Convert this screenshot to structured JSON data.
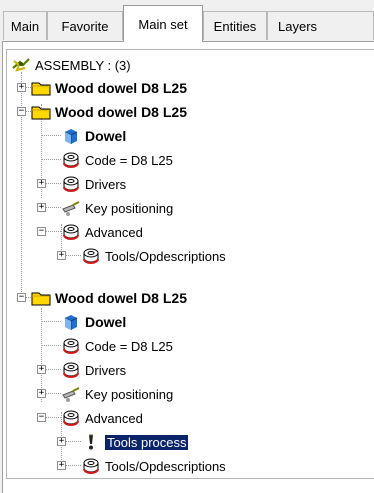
{
  "tabs": [
    {
      "label": "Main",
      "active": false
    },
    {
      "label": "Favorite",
      "active": false
    },
    {
      "label": "Main set",
      "active": true
    },
    {
      "label": "Entities",
      "active": false
    },
    {
      "label": "Layers",
      "active": false
    }
  ],
  "tree": {
    "root": {
      "label": "ASSEMBLY : (3)",
      "icon": "assembly-icon"
    },
    "nodes": [
      {
        "label": "Wood dowel D8 L25",
        "icon": "folder-icon",
        "expander": "+",
        "bold": true
      },
      {
        "label": "Wood dowel D8 L25",
        "icon": "folder-icon",
        "expander": "-",
        "bold": true
      },
      {
        "label": "Dowel",
        "icon": "dowel-icon",
        "bold": true
      },
      {
        "label": "Code = D8 L25",
        "icon": "disk-icon"
      },
      {
        "label": "Drivers",
        "icon": "disk-icon",
        "expander": "+"
      },
      {
        "label": "Key positioning",
        "icon": "key-positioning-icon",
        "expander": "+"
      },
      {
        "label": "Advanced",
        "icon": "disk-icon",
        "expander": "-"
      },
      {
        "label": "Tools/Opdescriptions",
        "icon": "disk-icon",
        "expander": "+"
      },
      {
        "label": "Wood dowel D8 L25",
        "icon": "folder-icon",
        "expander": "-",
        "bold": true
      },
      {
        "label": "Dowel",
        "icon": "dowel-icon",
        "bold": true
      },
      {
        "label": "Code = D8 L25",
        "icon": "disk-icon"
      },
      {
        "label": "Drivers",
        "icon": "disk-icon",
        "expander": "+"
      },
      {
        "label": "Key positioning",
        "icon": "key-positioning-icon",
        "expander": "+"
      },
      {
        "label": "Advanced",
        "icon": "disk-icon",
        "expander": "-"
      },
      {
        "label": "Tools process",
        "icon": "exclamation-icon",
        "expander": "+",
        "selected": true
      },
      {
        "label": "Tools/Opdescriptions",
        "icon": "disk-icon",
        "expander": "+"
      }
    ]
  },
  "colors": {
    "selection": "#0a246a",
    "folder": "#ffd800",
    "dowel": "#1f6fd1",
    "disk_red": "#d11b1b"
  }
}
